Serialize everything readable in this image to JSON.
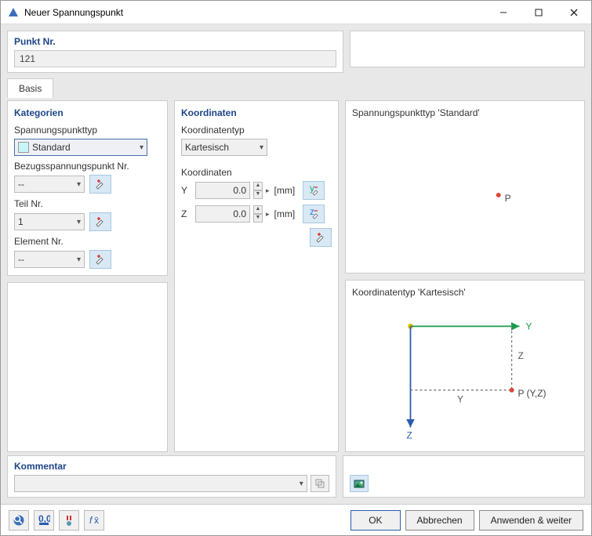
{
  "window": {
    "title": "Neuer Spannungspunkt"
  },
  "punktnr": {
    "label": "Punkt Nr.",
    "value": "121"
  },
  "tabs": {
    "basis": "Basis"
  },
  "kategorien": {
    "heading": "Kategorien",
    "spannungspunkttyp": {
      "label": "Spannungspunkttyp",
      "value": "Standard"
    },
    "bezugspunkt": {
      "label": "Bezugsspannungspunkt Nr.",
      "value": "--"
    },
    "teilnr": {
      "label": "Teil Nr.",
      "value": "1"
    },
    "elementnr": {
      "label": "Element Nr.",
      "value": "--"
    }
  },
  "koordinaten": {
    "heading": "Koordinaten",
    "koordinatentyp": {
      "label": "Koordinatentyp",
      "value": "Kartesisch"
    },
    "sublabel": "Koordinaten",
    "y": {
      "label": "Y",
      "value": "0.0",
      "unit": "[mm]"
    },
    "z": {
      "label": "Z",
      "value": "0.0",
      "unit": "[mm]"
    }
  },
  "preview": {
    "title1": "Spannungspunkttyp 'Standard'",
    "title2": "Koordinatentyp 'Kartesisch'",
    "p_label": "P",
    "y_axis": "Y",
    "z_axis": "Z",
    "z_dim": "Z",
    "y_dim": "Y",
    "p_coord": "P (Y,Z)"
  },
  "kommentar": {
    "heading": "Kommentar"
  },
  "buttons": {
    "ok": "OK",
    "cancel": "Abbrechen",
    "apply": "Anwenden & weiter"
  }
}
